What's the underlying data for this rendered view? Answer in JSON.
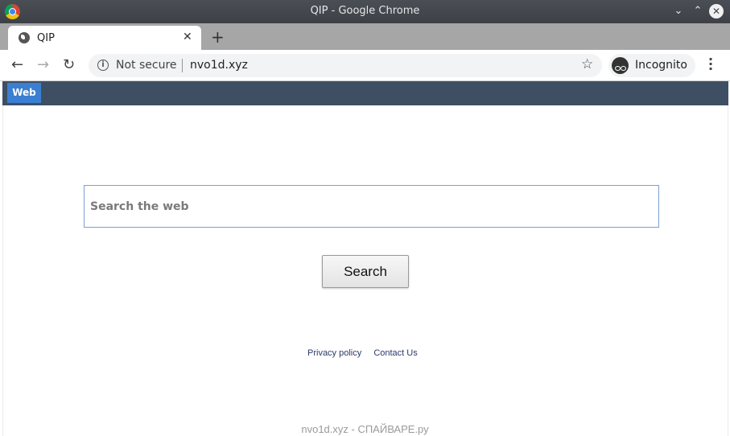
{
  "window": {
    "title": "QIP - Google Chrome"
  },
  "tab": {
    "title": "QIP"
  },
  "toolbar": {
    "security_label": "Not secure",
    "url": "nvo1d.xyz",
    "incognito_label": "Incognito"
  },
  "page": {
    "nav_tab_label": "Web",
    "search_placeholder": "Search the web",
    "search_button_label": "Search",
    "footer_links": [
      "Privacy policy",
      "Contact Us"
    ]
  },
  "watermark": "nvo1d.xyz - СПАЙВАРЕ.ру",
  "colors": {
    "page_nav_bg": "#3e4f63",
    "web_tab_bg": "#3a7fd1",
    "titlebar_bg": "#3d4147"
  }
}
